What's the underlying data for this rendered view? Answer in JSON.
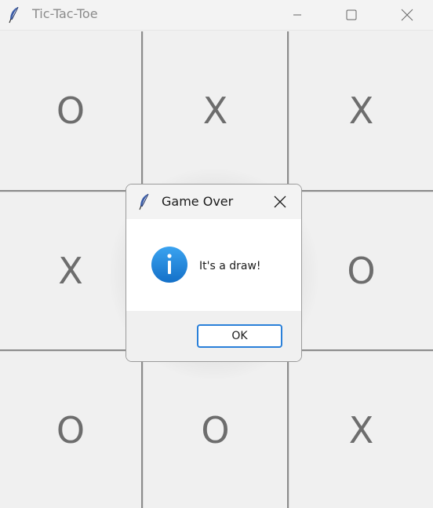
{
  "window": {
    "title": "Tic-Tac-Toe",
    "icons": {
      "app": "feather-icon",
      "minimize": "minimize-icon",
      "maximize": "maximize-icon",
      "close": "close-icon"
    }
  },
  "board": {
    "cells": [
      [
        "O",
        "X",
        "X"
      ],
      [
        "X",
        "",
        "O"
      ],
      [
        "O",
        "O",
        "X"
      ]
    ]
  },
  "dialog": {
    "title": "Game Over",
    "message": "It's a draw!",
    "ok_label": "OK",
    "icon": "info-icon",
    "colors": {
      "info_icon": "#1e88e5",
      "ok_border": "#2a80d9"
    }
  }
}
